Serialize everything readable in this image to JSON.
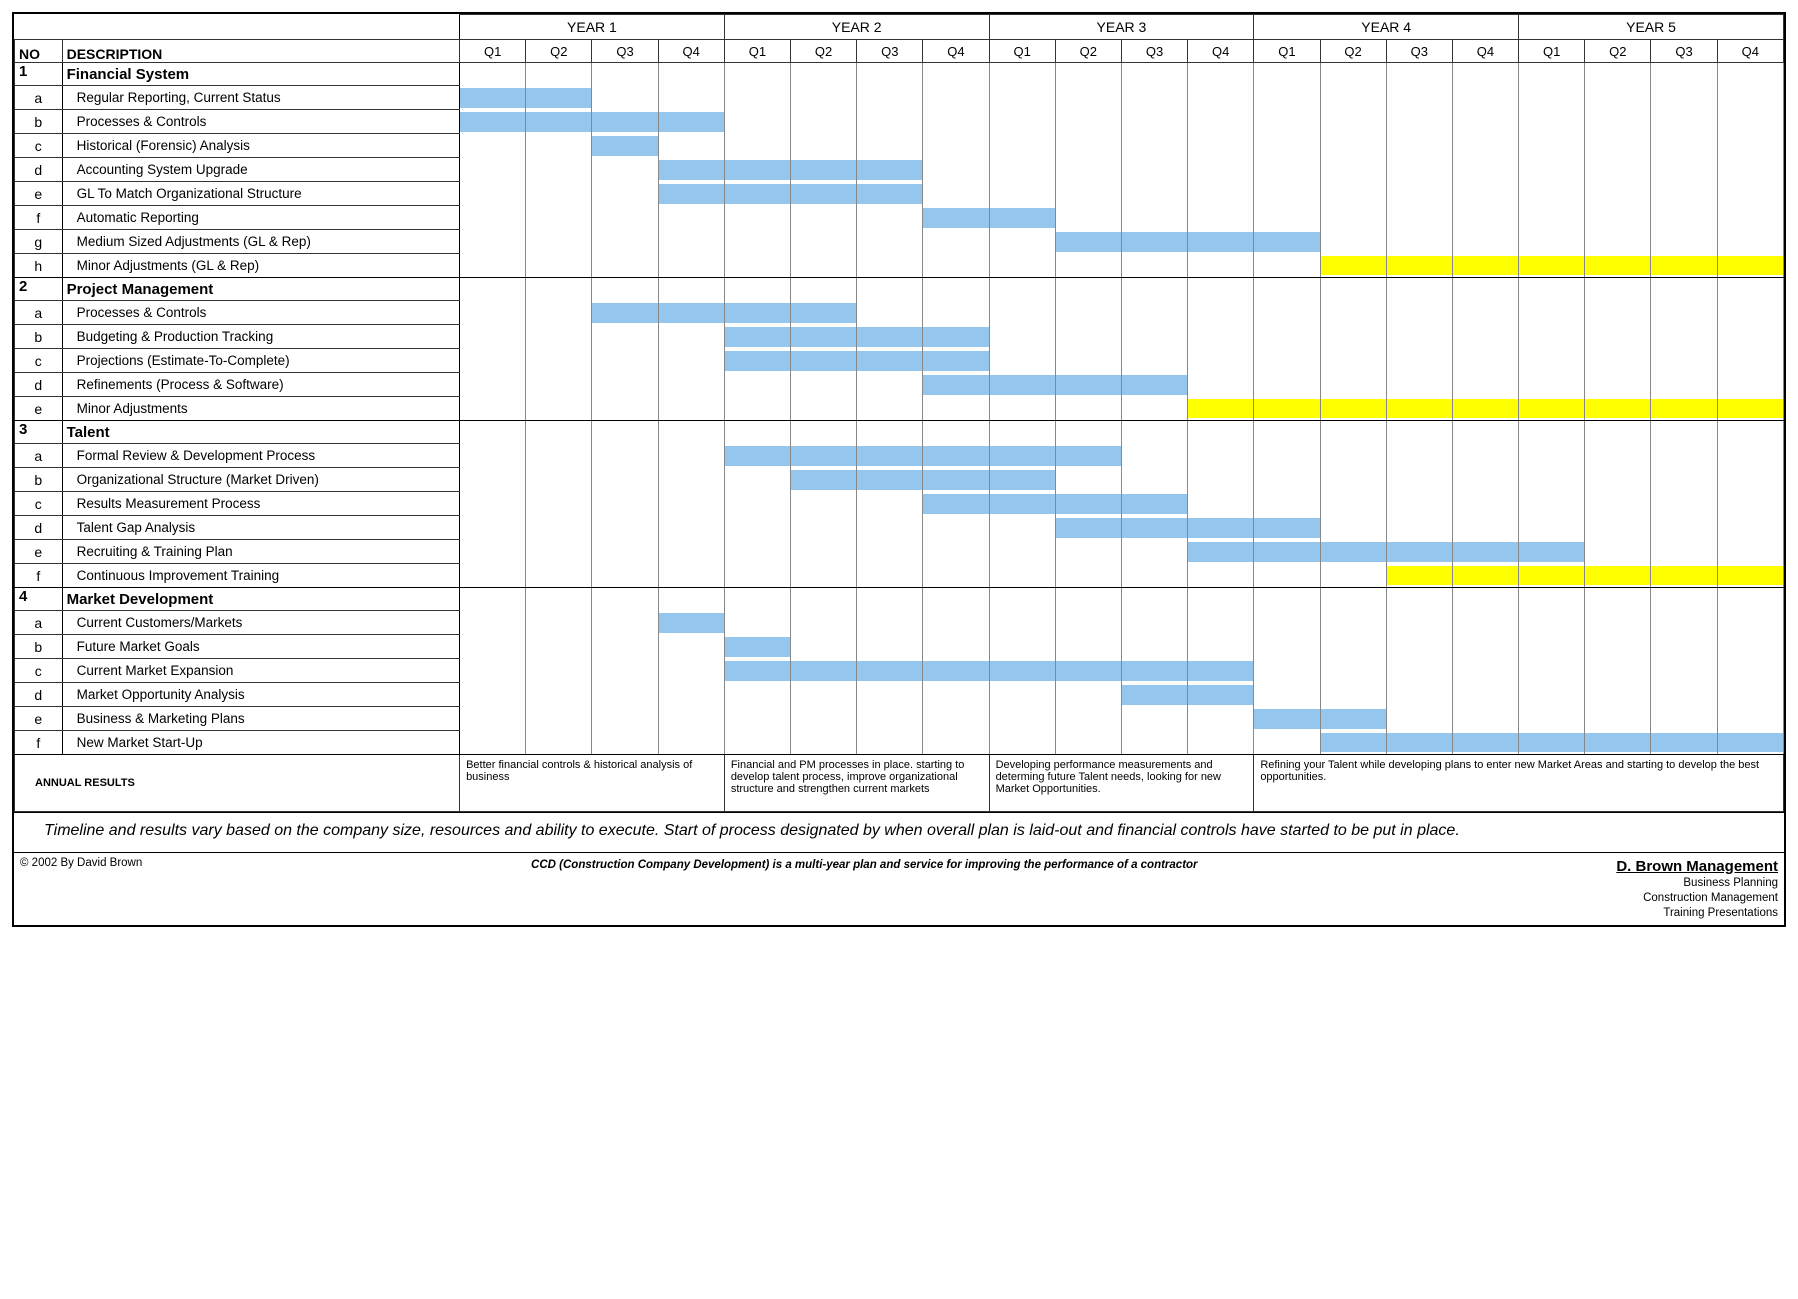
{
  "headers": {
    "no": "NO",
    "desc": "DESCRIPTION",
    "years": [
      "YEAR 1",
      "YEAR 2",
      "YEAR 3",
      "YEAR 4",
      "YEAR 5"
    ],
    "quarters": [
      "Q1",
      "Q2",
      "Q3",
      "Q4"
    ]
  },
  "sections": [
    {
      "no": "1",
      "title": "Financial System",
      "tasks": [
        {
          "id": "a",
          "label": "Regular Reporting, Current Status",
          "start": 0,
          "end": 2,
          "color": "blue"
        },
        {
          "id": "b",
          "label": "Processes & Controls",
          "start": 0,
          "end": 4,
          "color": "blue"
        },
        {
          "id": "c",
          "label": "Historical (Forensic) Analysis",
          "start": 2,
          "end": 3,
          "color": "blue"
        },
        {
          "id": "d",
          "label": "Accounting System Upgrade",
          "start": 3,
          "end": 7,
          "color": "blue"
        },
        {
          "id": "e",
          "label": "GL To Match Organizational Structure",
          "start": 3,
          "end": 7,
          "color": "blue"
        },
        {
          "id": "f",
          "label": "Automatic Reporting",
          "start": 7,
          "end": 9,
          "color": "blue"
        },
        {
          "id": "g",
          "label": "Medium Sized Adjustments (GL & Rep)",
          "start": 9,
          "end": 13,
          "color": "blue"
        },
        {
          "id": "h",
          "label": "Minor Adjustments (GL & Rep)",
          "start": 13,
          "end": 20,
          "color": "yellow"
        }
      ]
    },
    {
      "no": "2",
      "title": "Project Management",
      "tasks": [
        {
          "id": "a",
          "label": "Processes & Controls",
          "start": 2,
          "end": 6,
          "color": "blue"
        },
        {
          "id": "b",
          "label": "Budgeting & Production Tracking",
          "start": 4,
          "end": 8,
          "color": "blue"
        },
        {
          "id": "c",
          "label": "Projections (Estimate-To-Complete)",
          "start": 4,
          "end": 8,
          "color": "blue"
        },
        {
          "id": "d",
          "label": "Refinements (Process & Software)",
          "start": 7,
          "end": 11,
          "color": "blue"
        },
        {
          "id": "e",
          "label": "Minor Adjustments",
          "start": 11,
          "end": 20,
          "color": "yellow"
        }
      ]
    },
    {
      "no": "3",
      "title": "Talent",
      "tasks": [
        {
          "id": "a",
          "label": "Formal Review & Development Process",
          "start": 4,
          "end": 10,
          "color": "blue"
        },
        {
          "id": "b",
          "label": "Organizational Structure (Market Driven)",
          "start": 5,
          "end": 9,
          "color": "blue"
        },
        {
          "id": "c",
          "label": "Results Measurement Process",
          "start": 7,
          "end": 11,
          "color": "blue"
        },
        {
          "id": "d",
          "label": "Talent Gap Analysis",
          "start": 9,
          "end": 13,
          "color": "blue"
        },
        {
          "id": "e",
          "label": "Recruiting & Training Plan",
          "start": 11,
          "end": 17,
          "color": "blue"
        },
        {
          "id": "f",
          "label": "Continuous Improvement Training",
          "start": 14,
          "end": 20,
          "color": "yellow"
        }
      ]
    },
    {
      "no": "4",
      "title": "Market Development",
      "tasks": [
        {
          "id": "a",
          "label": "Current Customers/Markets",
          "start": 3,
          "end": 4,
          "color": "blue"
        },
        {
          "id": "b",
          "label": "Future Market Goals",
          "start": 4,
          "end": 5,
          "color": "blue"
        },
        {
          "id": "c",
          "label": "Current Market Expansion",
          "start": 4,
          "end": 12,
          "color": "blue"
        },
        {
          "id": "d",
          "label": "Market Opportunity Analysis",
          "start": 10,
          "end": 12,
          "color": "blue"
        },
        {
          "id": "e",
          "label": "Business & Marketing Plans",
          "start": 12,
          "end": 14,
          "color": "blue"
        },
        {
          "id": "f",
          "label": "New Market Start-Up",
          "start": 13,
          "end": 20,
          "color": "blue"
        }
      ]
    }
  ],
  "annual": {
    "label": "ANNUAL RESULTS",
    "results": [
      "Better financial controls & historical analysis of business",
      "Financial and PM processes in place. starting to develop talent process, improve organizational structure and strengthen current markets",
      "Developing performance measurements and determing future Talent needs, looking for new Market Opportunities.",
      "Refining your Talent while developing plans to enter new Market Areas and starting to develop the best opportunities."
    ]
  },
  "note": "Timeline and results vary based on the company size, resources and ability to execute.  Start of process designated by when overall plan is laid-out and financial controls have started to be put in place.",
  "footer": {
    "copyright": "© 2002 By David Brown",
    "tagline": "CCD (Construction Company Development) is a multi-year plan and service for improving the performance of a contractor",
    "brand": "D. Brown Management",
    "lines": [
      "Business Planning",
      "Construction Management",
      "Training Presentations"
    ]
  },
  "chart_data": {
    "type": "gantt",
    "unit": "quarter",
    "columns": 20,
    "note": "start/end are zero-indexed quarter positions; end is exclusive. YEAR1 Q1 = 0."
  }
}
